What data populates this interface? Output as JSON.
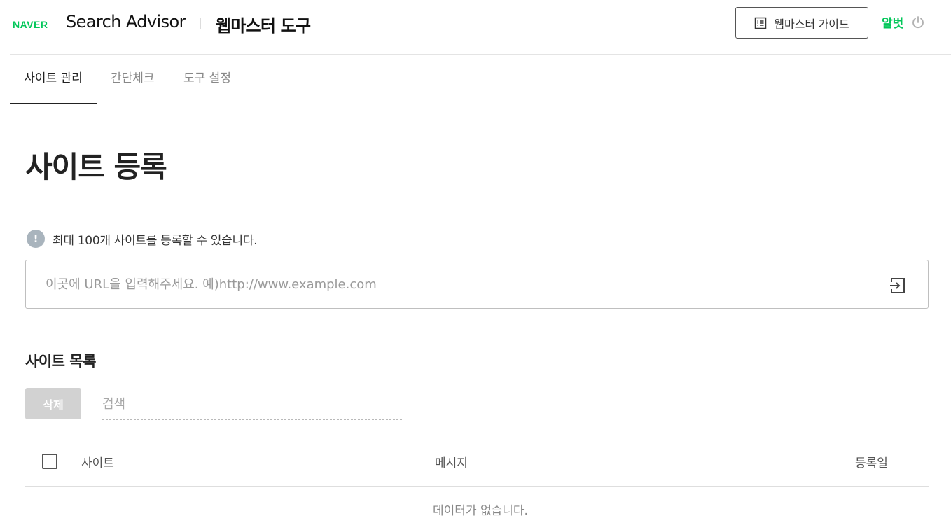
{
  "header": {
    "logo": "NAVER",
    "brand": "Search Advisor",
    "tool_title": "웹마스터 도구",
    "guide_button": "웹마스터 가이드",
    "user_name": "알벗"
  },
  "tabs": [
    {
      "label": "사이트 관리",
      "active": true
    },
    {
      "label": "간단체크",
      "active": false
    },
    {
      "label": "도구 설정",
      "active": false
    }
  ],
  "page_title": "사이트 등록",
  "notice": "최대 100개 사이트를 등록할 수 있습니다.",
  "url_input": {
    "placeholder": "이곳에 URL을 입력해주세요. 예)http://www.example.com",
    "value": ""
  },
  "site_list": {
    "title": "사이트 목록",
    "delete_button": "삭제",
    "search_placeholder": "검색",
    "columns": [
      "사이트",
      "메시지",
      "등록일"
    ],
    "rows": [],
    "empty_message": "데이터가 없습니다."
  },
  "colors": {
    "brand_green": "#03c75a",
    "info_icon": "#a9b4bd",
    "disabled_button": "#d2d2d2"
  }
}
